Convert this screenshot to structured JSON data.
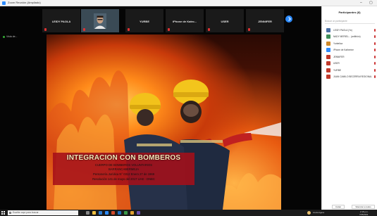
{
  "window": {
    "title": "Zoom Reunión (Ampliado)"
  },
  "participant_strip": [
    {
      "name": "LEIDY PAOLA",
      "type": "name"
    },
    {
      "name": "",
      "type": "video"
    },
    {
      "name": "YURBE",
      "type": "name"
    },
    {
      "name": "iPhone de Katro...",
      "type": "name"
    },
    {
      "name": "USER",
      "type": "name"
    },
    {
      "name": "JENNIFER",
      "type": "name"
    }
  ],
  "view_label": "Vista de...",
  "slide": {
    "title": "INTEGRACION CON BOMBEROS",
    "lines": [
      "CUERPO DE BOMBEROS VOLUNTARIOS",
      "BARRANCABERMEJA",
      "Personería Jurídica N° 0312 Enero 27 de 1969",
      "Resolución 141 de mayo del 2017 UAE - DNBC"
    ]
  },
  "panel": {
    "title": "Participantes (8)",
    "search_placeholder": "Buscar un participante",
    "participants": [
      {
        "name": "LEIDY PAOLA (Yo)",
        "color": "#4a6fa5"
      },
      {
        "name": "NADY MERIEL... (anfitrión)",
        "color": "#3f8f5a"
      },
      {
        "name": "Yurbelica",
        "color": "#d08a2a"
      },
      {
        "name": "iPhone de Katherine",
        "color": "#2d8cff"
      },
      {
        "name": "JENNIFER",
        "color": "#c0392b"
      },
      {
        "name": "USER",
        "color": "#c0392b"
      },
      {
        "name": "YURBE",
        "color": "#c0392b"
      },
      {
        "name": "JUAN CAMILO BECERRA REGIONAL",
        "color": "#c0392b"
      }
    ],
    "invite_label": "Invitar",
    "mute_all_label": "Silenciar a todos"
  },
  "taskbar": {
    "search_placeholder": "Escribe aquí para buscar",
    "weather": "Lluvia ligera",
    "time": "2:18 p.m.",
    "date": "7/05/2021"
  }
}
